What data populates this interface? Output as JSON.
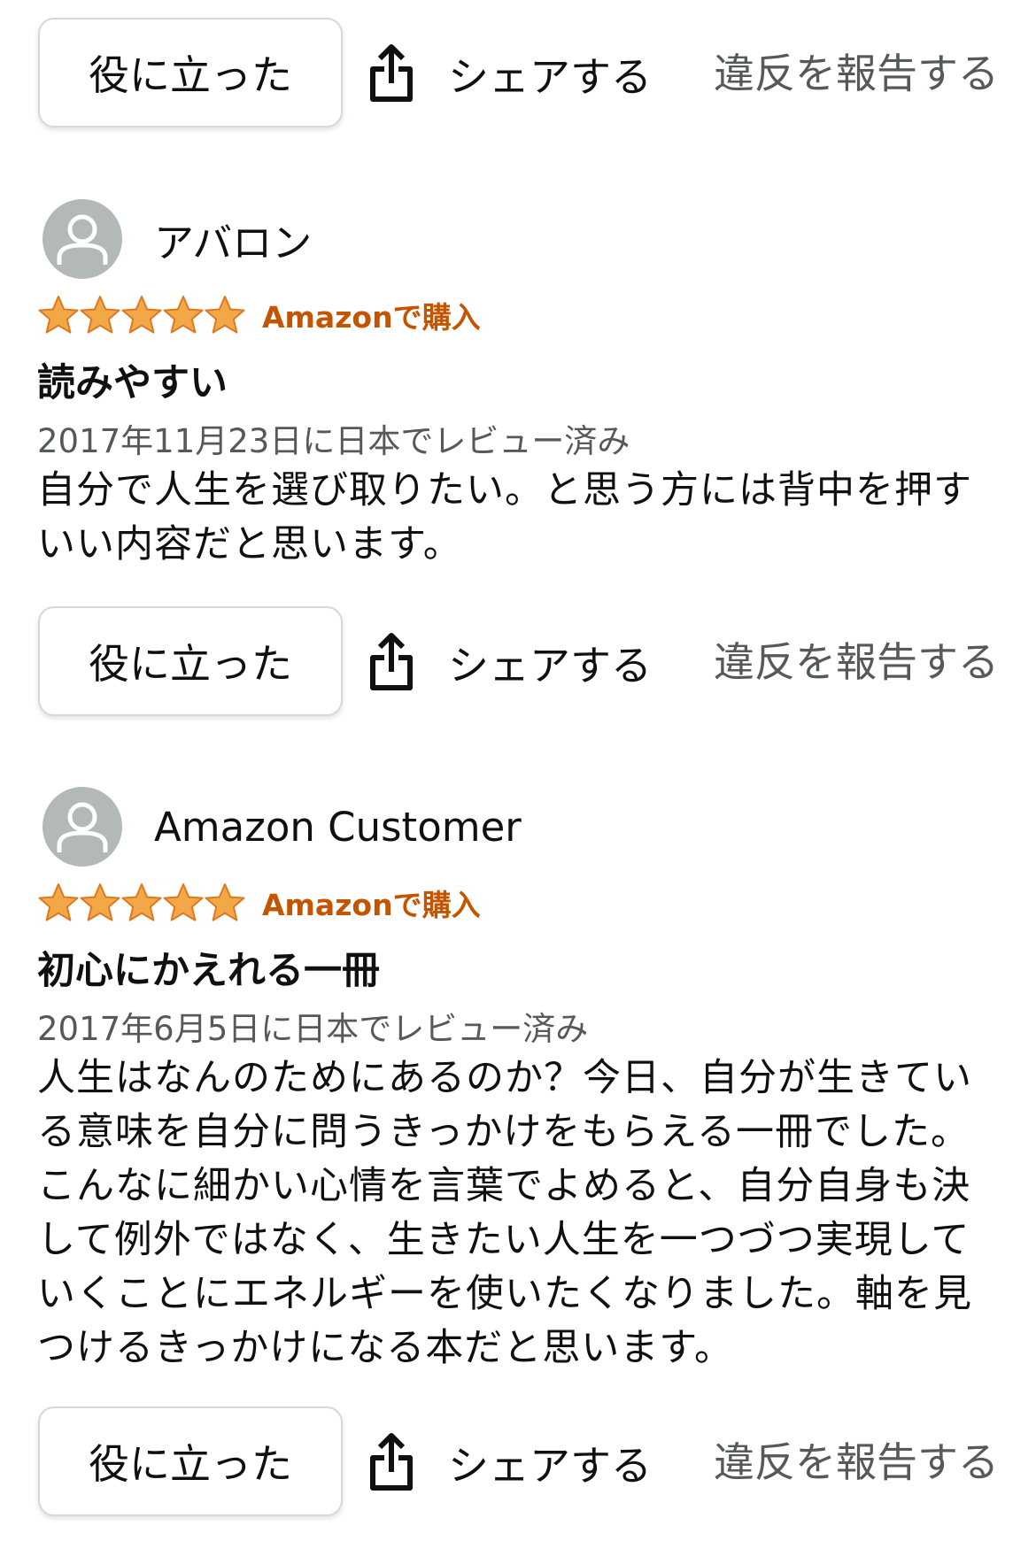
{
  "actions": {
    "helpful_label": "役に立った",
    "share_label": "シェアする",
    "report_label": "違反を報告する"
  },
  "colors": {
    "star": "#f3a847",
    "verified": "#c45500",
    "muted_text": "#565959",
    "avatar_bg": "#b3b8b8"
  },
  "icons": {
    "share": "share-icon",
    "avatar": "default-avatar-icon",
    "star": "star-icon"
  },
  "reviews": [
    {
      "reviewer": "アバロン",
      "rating": 5,
      "rating_max": 5,
      "verified": "Amazonで購入",
      "title": "読みやすい",
      "date": "2017年11月23日に日本でレビュー済み",
      "body_lines": [
        "自分で人生を選び取りたい。と思う方には背中を押す",
        "いい内容だと思います。"
      ]
    },
    {
      "reviewer": "Amazon Customer",
      "rating": 5,
      "rating_max": 5,
      "verified": "Amazonで購入",
      "title": "初心にかえれる一冊",
      "date": "2017年6月5日に日本でレビュー済み",
      "body_lines": [
        "人生はなんのためにあるのか？今日、自分が生きてい",
        "る意味を自分に問うきっかけをもらえる一冊でした。",
        "こんなに細かい心情を言葉でよめると、自分自身も決",
        "して例外ではなく、生きたい人生を一つづつ実現して",
        "いくことにエネルギーを使いたくなりました。軸を見",
        "つけるきっかけになる本だと思います。"
      ]
    }
  ]
}
